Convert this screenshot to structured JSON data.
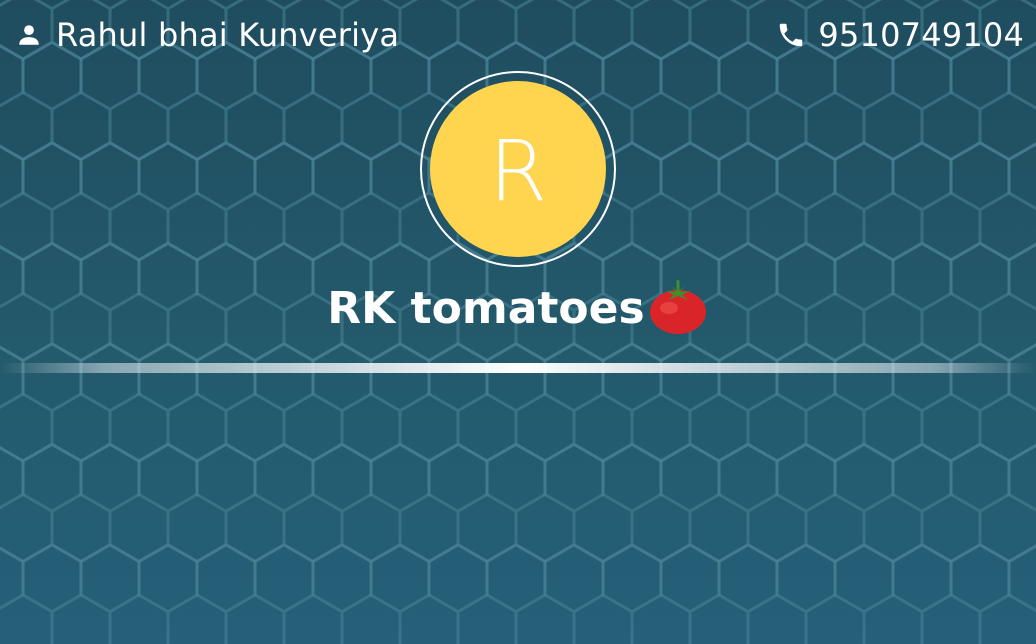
{
  "header": {
    "owner_icon": "person-icon",
    "owner_name": "Rahul bhai Kunveriya",
    "phone_icon": "phone-icon",
    "phone_number": "9510749104"
  },
  "profile": {
    "avatar_letter": "R",
    "avatar_color": "#ffd54f",
    "business_name": "RK tomatoes",
    "business_emoji_icon": "tomato-icon"
  },
  "theme": {
    "background": "#1f4d5f",
    "pattern": "hexagon"
  }
}
